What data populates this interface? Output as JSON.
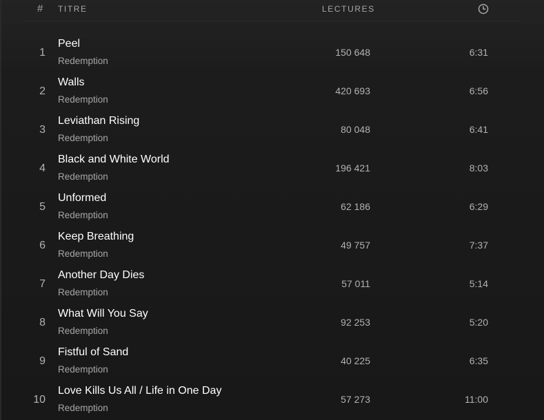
{
  "header": {
    "number_label": "#",
    "title_label": "TITRE",
    "plays_label": "LECTURES",
    "duration_icon": "clock-icon"
  },
  "tracks": [
    {
      "number": "1",
      "title": "Peel",
      "artist": "Redemption",
      "plays": "150 648",
      "duration": "6:31"
    },
    {
      "number": "2",
      "title": "Walls",
      "artist": "Redemption",
      "plays": "420 693",
      "duration": "6:56"
    },
    {
      "number": "3",
      "title": "Leviathan Rising",
      "artist": "Redemption",
      "plays": "80 048",
      "duration": "6:41"
    },
    {
      "number": "4",
      "title": "Black and White World",
      "artist": "Redemption",
      "plays": "196 421",
      "duration": "8:03"
    },
    {
      "number": "5",
      "title": "Unformed",
      "artist": "Redemption",
      "plays": "62 186",
      "duration": "6:29"
    },
    {
      "number": "6",
      "title": "Keep Breathing",
      "artist": "Redemption",
      "plays": "49 757",
      "duration": "7:37"
    },
    {
      "number": "7",
      "title": "Another Day Dies",
      "artist": "Redemption",
      "plays": "57 011",
      "duration": "5:14"
    },
    {
      "number": "8",
      "title": "What Will You Say",
      "artist": "Redemption",
      "plays": "92 253",
      "duration": "5:20"
    },
    {
      "number": "9",
      "title": "Fistful of Sand",
      "artist": "Redemption",
      "plays": "40 225",
      "duration": "6:35"
    },
    {
      "number": "10",
      "title": "Love Kills Us All / Life in One Day",
      "artist": "Redemption",
      "plays": "57 273",
      "duration": "11:00"
    }
  ],
  "colors": {
    "background": "#181818",
    "title_text": "#ffffff",
    "secondary_text": "#b3b3b3",
    "divider": "#2f2f2f"
  }
}
